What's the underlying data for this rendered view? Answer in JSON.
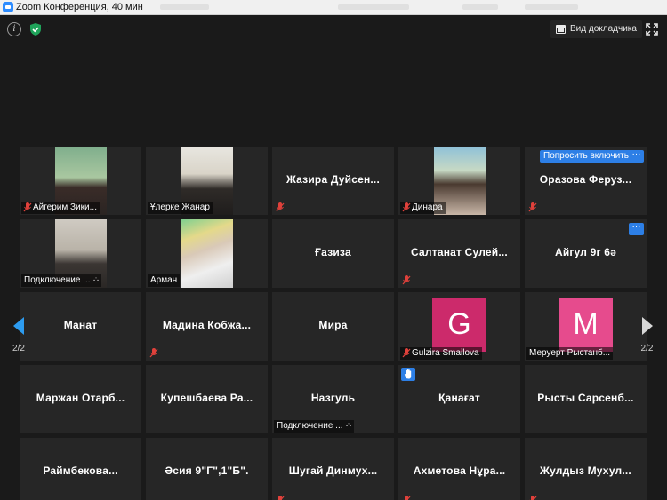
{
  "window": {
    "title": "Zoom Конференция, 40 мин"
  },
  "toolbar": {
    "speaker_view_label": "Вид докладчика"
  },
  "colors": {
    "accent": "#2d7fe6",
    "muted_icon": "#e0413b",
    "tile_bg": "#262626",
    "avatar_g": "#cc2a6b",
    "avatar_m": "#e64b8d"
  },
  "pagination": {
    "prev_page": "2/2",
    "next_page": "2/2"
  },
  "tiles": {
    "t1": {
      "name": "Айгерим Зики..."
    },
    "t2": {
      "name": "Ұлерке Жанар"
    },
    "t3": {
      "name": "Жазира  Дуйсен..."
    },
    "t4": {
      "name": "Динара"
    },
    "t5": {
      "name": "Оразова  Феруз...",
      "ask_label": "Попросить включить",
      "more": "···"
    },
    "t6": {
      "name": "Подключение ..."
    },
    "t7": {
      "name": "Арман"
    },
    "t8": {
      "name": "Ғазиза"
    },
    "t9": {
      "name": "Салтанат  Сулей..."
    },
    "t10": {
      "name": "Айгул 9г 6ә",
      "more": "···"
    },
    "t11": {
      "name": "Манат"
    },
    "t12": {
      "name": "Мадина  Кобжа..."
    },
    "t13": {
      "name": "Мира"
    },
    "t14": {
      "name": "Gulzira Smailova",
      "avatar_letter": "G"
    },
    "t15": {
      "name": "Меруерт Рыстанб...",
      "avatar_letter": "M"
    },
    "t16": {
      "name": "Маржан  Отарб..."
    },
    "t17": {
      "name": "Купешбаева  Ра..."
    },
    "t18": {
      "name": "Назгуль",
      "status": "Подключение ..."
    },
    "t19": {
      "name": "Қанағат"
    },
    "t20": {
      "name": "Рысты  Сарсенб..."
    },
    "t21": {
      "name": "Раймбекова..."
    },
    "t22": {
      "name": "Әсия 9\"Г\",1\"Б\"."
    },
    "t23": {
      "name": "Шугай  Динмух..."
    },
    "t24": {
      "name": "Ахметова  Нұра..."
    },
    "t25": {
      "name": "Жулдыз  Мухул..."
    }
  }
}
